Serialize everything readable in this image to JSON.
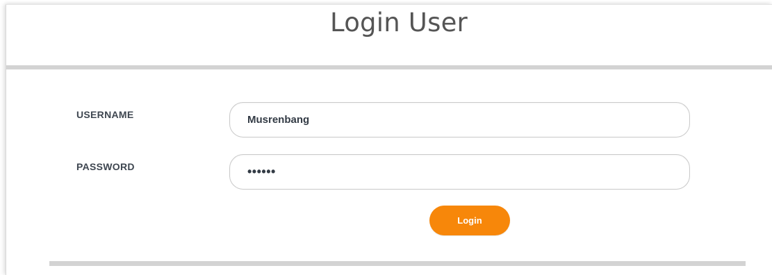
{
  "header": {
    "title": "Login User"
  },
  "form": {
    "username": {
      "label": "USERNAME",
      "value": "Musrenbang"
    },
    "password": {
      "label": "PASSWORD",
      "masked_value": "••••••"
    },
    "submit_label": "Login"
  },
  "colors": {
    "accent": "#f7870a",
    "divider": "#d3d3d3",
    "title_text": "#555555",
    "label_text": "#3e4650"
  }
}
